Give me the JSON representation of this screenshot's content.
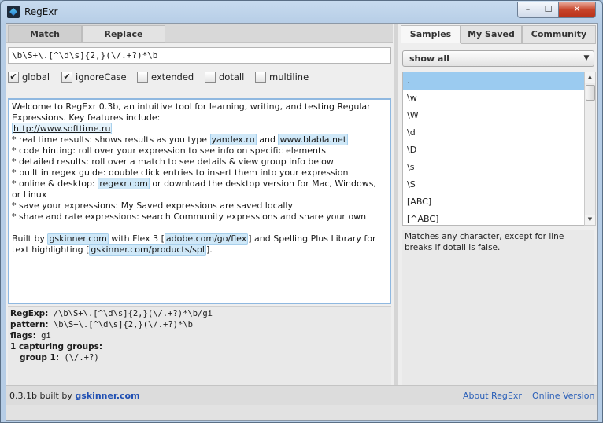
{
  "window": {
    "title": "RegExr",
    "min_glyph": "–",
    "max_glyph": "☐",
    "close_glyph": "✕"
  },
  "left_tabs": [
    "Match",
    "Replace"
  ],
  "regex_input": "\\b\\S+\\.[^\\d\\s]{2,}(\\/.+?)*\\b",
  "flags": [
    {
      "label": "global",
      "checked": true
    },
    {
      "label": "ignoreCase",
      "checked": true
    },
    {
      "label": "extended",
      "checked": false
    },
    {
      "label": "dotall",
      "checked": false
    },
    {
      "label": "multiline",
      "checked": false
    }
  ],
  "sample_text": {
    "intro": "Welcome to RegExr 0.3b, an intuitive tool for learning, writing, and testing Regular Expressions. Key features include:",
    "link1": "http://www.softtime.ru",
    "f1a": "* real time results: shows results as you type ",
    "f1m1": "yandex.ru",
    "f1b": " and ",
    "f1m2": "www.blabla.net",
    "f2": "* code hinting: roll over your expression to see info on specific elements",
    "f3": "* detailed results: roll over a match to see details & view group info below",
    "f4": "* built in regex guide: double click entries to insert them into your expression",
    "f5a": "* online & desktop: ",
    "f5m": "regexr.com",
    "f5b": " or download the desktop version for Mac, Windows, or Linux",
    "f6": "* save your expressions: My Saved expressions are saved locally",
    "f7": "* share and rate expressions: search Community expressions and share your own",
    "b1": "Built by ",
    "bm1": "gskinner.com",
    "b2": " with Flex 3 [",
    "bm2": "adobe.com/go/flex",
    "b3": "] and Spelling Plus Library for text highlighting [",
    "bm3": "gskinner.com/products/spl",
    "b4": "]."
  },
  "details": {
    "regexp_label": "RegExp:",
    "regexp_value": "/\\b\\S+\\.[^\\d\\s]{2,}(\\/.+?)*\\b/gi",
    "pattern_label": "pattern:",
    "pattern_value": "\\b\\S+\\.[^\\d\\s]{2,}(\\/.+?)*\\b",
    "flags_label": "flags:",
    "flags_value": "gi",
    "groups_label": "1 capturing groups:",
    "group1_label": "group 1:",
    "group1_value": "(\\/.+?)"
  },
  "footer": {
    "version_prefix": "0.3.1b built by ",
    "version_link": "gskinner.com",
    "about": "About RegExr",
    "online": "Online Version"
  },
  "right_tabs": [
    "Samples",
    "My Saved",
    "Community"
  ],
  "category_select": "show all",
  "samples": [
    ".",
    "\\w",
    "\\W",
    "\\d",
    "\\D",
    "\\s",
    "\\S",
    "[ABC]",
    "[^ABC]"
  ],
  "sample_description": "Matches any character, except for line breaks if dotall is false."
}
